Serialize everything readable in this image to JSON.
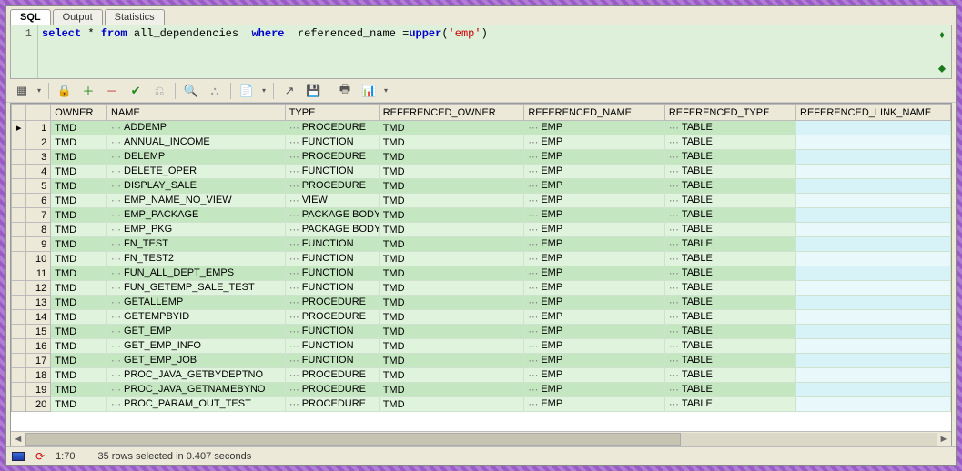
{
  "tabs": {
    "sql": "SQL",
    "output": "Output",
    "statistics": "Statistics"
  },
  "editor": {
    "line_no": "1",
    "tokens": {
      "select": "select",
      "star": "*",
      "from": "from",
      "table": "all_dependencies",
      "where": "where",
      "col": "referenced_name",
      "eq": "=",
      "upper": "upper",
      "lp": "(",
      "str": "'emp'",
      "rp": ")"
    }
  },
  "columns": {
    "owner": "OWNER",
    "name": "NAME",
    "type": "TYPE",
    "ref_owner": "REFERENCED_OWNER",
    "ref_name": "REFERENCED_NAME",
    "ref_type": "REFERENCED_TYPE",
    "ref_link": "REFERENCED_LINK_NAME"
  },
  "rows": [
    {
      "n": "1",
      "owner": "TMD",
      "name": "ADDEMP",
      "type": "PROCEDURE",
      "rowner": "TMD",
      "rname": "EMP",
      "rtype": "TABLE",
      "rlink": ""
    },
    {
      "n": "2",
      "owner": "TMD",
      "name": "ANNUAL_INCOME",
      "type": "FUNCTION",
      "rowner": "TMD",
      "rname": "EMP",
      "rtype": "TABLE",
      "rlink": ""
    },
    {
      "n": "3",
      "owner": "TMD",
      "name": "DELEMP",
      "type": "PROCEDURE",
      "rowner": "TMD",
      "rname": "EMP",
      "rtype": "TABLE",
      "rlink": ""
    },
    {
      "n": "4",
      "owner": "TMD",
      "name": "DELETE_OPER",
      "type": "FUNCTION",
      "rowner": "TMD",
      "rname": "EMP",
      "rtype": "TABLE",
      "rlink": ""
    },
    {
      "n": "5",
      "owner": "TMD",
      "name": "DISPLAY_SALE",
      "type": "PROCEDURE",
      "rowner": "TMD",
      "rname": "EMP",
      "rtype": "TABLE",
      "rlink": ""
    },
    {
      "n": "6",
      "owner": "TMD",
      "name": "EMP_NAME_NO_VIEW",
      "type": "VIEW",
      "rowner": "TMD",
      "rname": "EMP",
      "rtype": "TABLE",
      "rlink": ""
    },
    {
      "n": "7",
      "owner": "TMD",
      "name": "EMP_PACKAGE",
      "type": "PACKAGE BODY",
      "rowner": "TMD",
      "rname": "EMP",
      "rtype": "TABLE",
      "rlink": ""
    },
    {
      "n": "8",
      "owner": "TMD",
      "name": "EMP_PKG",
      "type": "PACKAGE BODY",
      "rowner": "TMD",
      "rname": "EMP",
      "rtype": "TABLE",
      "rlink": ""
    },
    {
      "n": "9",
      "owner": "TMD",
      "name": "FN_TEST",
      "type": "FUNCTION",
      "rowner": "TMD",
      "rname": "EMP",
      "rtype": "TABLE",
      "rlink": ""
    },
    {
      "n": "10",
      "owner": "TMD",
      "name": "FN_TEST2",
      "type": "FUNCTION",
      "rowner": "TMD",
      "rname": "EMP",
      "rtype": "TABLE",
      "rlink": ""
    },
    {
      "n": "11",
      "owner": "TMD",
      "name": "FUN_ALL_DEPT_EMPS",
      "type": "FUNCTION",
      "rowner": "TMD",
      "rname": "EMP",
      "rtype": "TABLE",
      "rlink": ""
    },
    {
      "n": "12",
      "owner": "TMD",
      "name": "FUN_GETEMP_SALE_TEST",
      "type": "FUNCTION",
      "rowner": "TMD",
      "rname": "EMP",
      "rtype": "TABLE",
      "rlink": ""
    },
    {
      "n": "13",
      "owner": "TMD",
      "name": "GETALLEMP",
      "type": "PROCEDURE",
      "rowner": "TMD",
      "rname": "EMP",
      "rtype": "TABLE",
      "rlink": ""
    },
    {
      "n": "14",
      "owner": "TMD",
      "name": "GETEMPBYID",
      "type": "PROCEDURE",
      "rowner": "TMD",
      "rname": "EMP",
      "rtype": "TABLE",
      "rlink": ""
    },
    {
      "n": "15",
      "owner": "TMD",
      "name": "GET_EMP",
      "type": "FUNCTION",
      "rowner": "TMD",
      "rname": "EMP",
      "rtype": "TABLE",
      "rlink": ""
    },
    {
      "n": "16",
      "owner": "TMD",
      "name": "GET_EMP_INFO",
      "type": "FUNCTION",
      "rowner": "TMD",
      "rname": "EMP",
      "rtype": "TABLE",
      "rlink": ""
    },
    {
      "n": "17",
      "owner": "TMD",
      "name": "GET_EMP_JOB",
      "type": "FUNCTION",
      "rowner": "TMD",
      "rname": "EMP",
      "rtype": "TABLE",
      "rlink": ""
    },
    {
      "n": "18",
      "owner": "TMD",
      "name": "PROC_JAVA_GETBYDEPTNO",
      "type": "PROCEDURE",
      "rowner": "TMD",
      "rname": "EMP",
      "rtype": "TABLE",
      "rlink": ""
    },
    {
      "n": "19",
      "owner": "TMD",
      "name": "PROC_JAVA_GETNAMEBYNO",
      "type": "PROCEDURE",
      "rowner": "TMD",
      "rname": "EMP",
      "rtype": "TABLE",
      "rlink": ""
    },
    {
      "n": "20",
      "owner": "TMD",
      "name": "PROC_PARAM_OUT_TEST",
      "type": "PROCEDURE",
      "rowner": "TMD",
      "rname": "EMP",
      "rtype": "TABLE",
      "rlink": ""
    }
  ],
  "status": {
    "pos": "1:70",
    "msg": "35 rows selected in 0.407 seconds"
  }
}
